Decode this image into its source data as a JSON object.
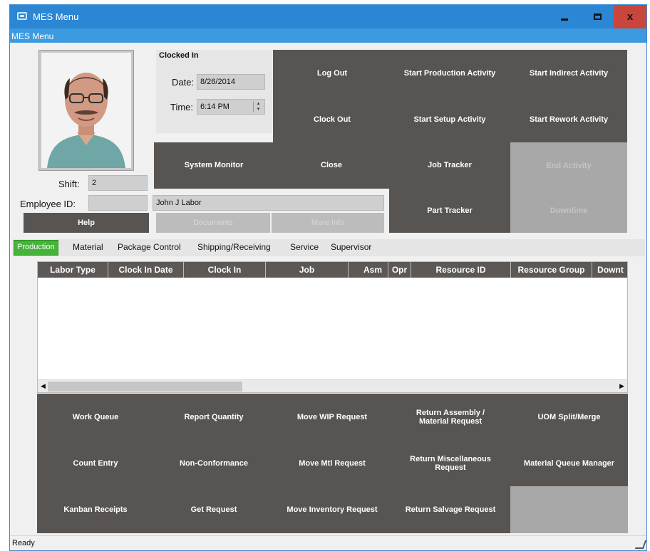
{
  "window": {
    "title": "MES Menu",
    "menu_label": "MES Menu"
  },
  "clock": {
    "title": "Clocked In",
    "date_label": "Date:",
    "date_value": "8/26/2014",
    "time_label": "Time:",
    "time_value": "6:14 PM"
  },
  "employee": {
    "shift_label": "Shift:",
    "shift_value": "2",
    "id_label": "Employee ID:",
    "id_value": "",
    "name": "John J Labor"
  },
  "buttons": {
    "help": "Help",
    "documents": "Documents",
    "more_info": "More Info",
    "system_monitor": "System Monitor",
    "log_out": "Log Out",
    "clock_out": "Clock Out",
    "close": "Close",
    "start_production": "Start Production Activity",
    "start_setup": "Start Setup Activity",
    "job_tracker": "Job Tracker",
    "part_tracker": "Part Tracker",
    "start_indirect": "Start Indirect Activity",
    "start_rework": "Start Rework Activity",
    "end_activity": "End Activity",
    "downtime": "Downtime"
  },
  "tabs": [
    "Production",
    "Material",
    "Package Control",
    "Shipping/Receiving",
    "Service",
    "Supervisor"
  ],
  "grid_columns": [
    "Labor Type",
    "Clock In Date",
    "Clock In",
    "Job",
    "Asm",
    "Opr",
    "Resource ID",
    "Resource Group",
    "Downt"
  ],
  "actions": [
    [
      "Work Queue",
      "Report Quantity",
      "Move WIP Request",
      "Return Assembly / Material Request",
      "UOM Split/Merge"
    ],
    [
      "Count Entry",
      "Non-Conformance",
      "Move Mtl Request",
      "Return Miscellaneous Request",
      "Material Queue Manager"
    ],
    [
      "Kanban Receipts",
      "Get Request",
      "Move Inventory Request",
      "Return Salvage Request",
      ""
    ]
  ],
  "status": "Ready",
  "colors": {
    "titlebar": "#2b87d3",
    "button_dark": "#585452",
    "tab_active": "#46b43b",
    "close": "#c9463d"
  },
  "icons": [
    "app-window-icon",
    "minimize-icon",
    "maximize-icon",
    "close-icon",
    "spin-icon",
    "scroll-left-icon",
    "scroll-right-icon",
    "resize-grip-icon"
  ]
}
